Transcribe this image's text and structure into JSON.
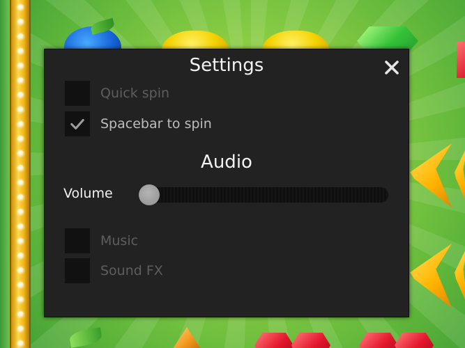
{
  "settings": {
    "title": "Settings",
    "close_symbol": "×",
    "options": {
      "quick_spin": {
        "label": "Quick spin",
        "checked": false
      },
      "spacebar_to_spin": {
        "label": "Spacebar to spin",
        "checked": true
      }
    },
    "audio": {
      "title": "Audio",
      "volume_label": "Volume",
      "volume_level": 0,
      "music": {
        "label": "Music",
        "checked": false
      },
      "sound_fx": {
        "label": "Sound FX",
        "checked": false
      }
    }
  },
  "icons": {
    "close": "close-icon",
    "check": "checkmark-icon"
  },
  "colors": {
    "panel": "#222222",
    "checkbox": "#111111",
    "thumb": "#9a9a9a",
    "marquee": "#f2b617"
  }
}
